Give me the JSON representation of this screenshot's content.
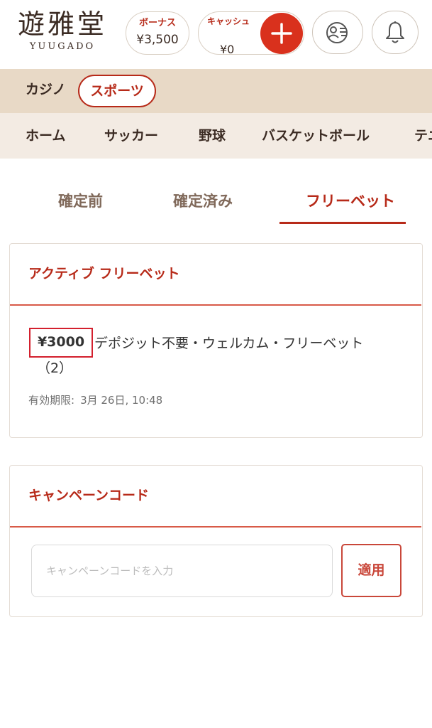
{
  "header": {
    "logo_kanji": "遊雅堂",
    "logo_latin": "YUUGADO",
    "bonus": {
      "label": "ボーナス",
      "value": "¥3,500"
    },
    "cash": {
      "label": "キャッシュ",
      "value": "¥0"
    },
    "icons": [
      "plus-icon",
      "user-card-icon",
      "bell-icon"
    ]
  },
  "categories": {
    "casino": "カジノ",
    "sports": "スポーツ"
  },
  "sports_nav": {
    "items": [
      "ホーム",
      "サッカー",
      "野球",
      "バスケットボール",
      "テニ"
    ]
  },
  "tabs": {
    "items": [
      "確定前",
      "確定済み",
      "フリーベット"
    ],
    "active": "フリーベット"
  },
  "active_freebet": {
    "title": "アクティブ フリーベット",
    "amount": "¥3000",
    "description": "デポジット不要・ウェルカム・フリーベット",
    "count": "（2）",
    "expiry_label": "有効期限:",
    "expiry_value": "3月 26日, 10:48"
  },
  "campaign": {
    "title": "キャンペーンコード",
    "input_placeholder": "キャンペーンコードを入力",
    "apply_label": "適用"
  },
  "colors": {
    "accent": "#b72a19",
    "plus_button": "#d9311d",
    "category_bar": "#e8d9c6",
    "sports_nav": "#f3ebe3",
    "highlight_box": "#d3202e"
  }
}
